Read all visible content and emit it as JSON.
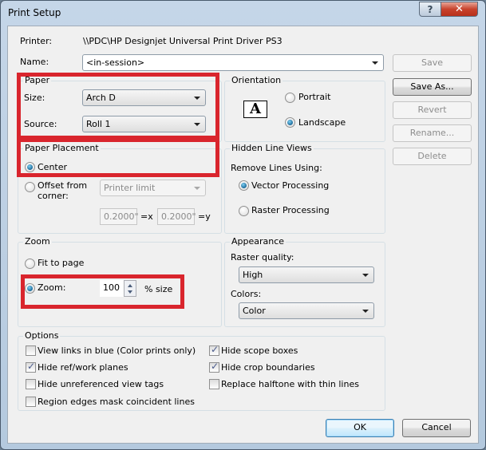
{
  "window": {
    "title": "Print Setup",
    "help_glyph": "?",
    "close_glyph": "✕"
  },
  "printer": {
    "label": "Printer:",
    "value": "\\\\PDC\\HP Designjet Universal Print Driver PS3"
  },
  "name": {
    "label": "Name:",
    "value": "<in-session>"
  },
  "side_buttons": {
    "save": "Save",
    "save_as": "Save As...",
    "revert": "Revert",
    "rename": "Rename...",
    "delete": "Delete"
  },
  "paper": {
    "title": "Paper",
    "size_label": "Size:",
    "size_value": "Arch D",
    "source_label": "Source:",
    "source_value": "Roll 1"
  },
  "orientation": {
    "title": "Orientation",
    "icon_letter": "A",
    "portrait_label": "Portrait",
    "landscape_label": "Landscape",
    "selected": "landscape"
  },
  "paper_placement": {
    "title": "Paper Placement",
    "center_label": "Center",
    "offset_label_line1": "Offset from",
    "offset_label_line2": "corner:",
    "offset_dropdown": "Printer limit",
    "x_value": "0.2000\"",
    "x_label": "=x",
    "y_value": "0.2000\"",
    "y_label": "=y",
    "selected": "center"
  },
  "hidden_line_views": {
    "title": "Hidden Line Views",
    "remove_label": "Remove Lines Using:",
    "vector_label": "Vector Processing",
    "raster_label": "Raster Processing",
    "selected": "vector"
  },
  "zoom": {
    "title": "Zoom",
    "fit_label": "Fit to page",
    "zoom_label": "Zoom:",
    "zoom_value": "100",
    "size_suffix": "% size",
    "selected": "zoom"
  },
  "appearance": {
    "title": "Appearance",
    "raster_quality_label": "Raster quality:",
    "raster_quality_value": "High",
    "colors_label": "Colors:",
    "colors_value": "Color"
  },
  "options": {
    "title": "Options",
    "items": [
      {
        "label": "View links in blue (Color prints only)",
        "checked": false
      },
      {
        "label": "Hide ref/work planes",
        "checked": true
      },
      {
        "label": "Hide unreferenced view tags",
        "checked": false
      },
      {
        "label": "Region edges mask coincident lines",
        "checked": false
      },
      {
        "label": "Hide scope boxes",
        "checked": true
      },
      {
        "label": "Hide crop boundaries",
        "checked": true
      },
      {
        "label": "Replace halftone with thin lines",
        "checked": false
      }
    ]
  },
  "footer": {
    "ok": "OK",
    "cancel": "Cancel"
  },
  "colors": {
    "highlight_red": "#d9252d",
    "radio_selected": "#1c6a9a"
  }
}
